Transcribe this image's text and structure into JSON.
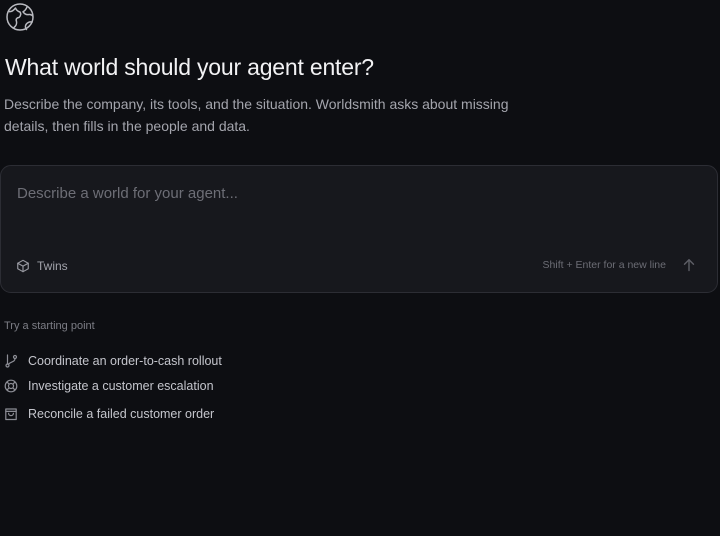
{
  "app": {
    "logo_icon": "globe-icon"
  },
  "header": {
    "title": "What world should your agent enter?",
    "subtitle": "Describe the company, its tools, and the situation. Worldsmith asks about missing details, then fills in the people and data."
  },
  "composer": {
    "placeholder": "Describe a world for your agent...",
    "value": "",
    "twins_label": "Twins",
    "twins_icon": "cube-icon",
    "hint": "Shift + Enter for a new line",
    "send_icon": "arrow-up-icon"
  },
  "starters": {
    "heading": "Try a starting point",
    "items": [
      {
        "label": "Coordinate an order-to-cash rollout",
        "icon": "git-branch-icon"
      },
      {
        "label": "Investigate a customer escalation",
        "icon": "life-buoy-icon"
      },
      {
        "label": "Reconcile a failed customer order",
        "icon": "shopping-bag-icon"
      }
    ]
  },
  "colors": {
    "background": "#0d0e12",
    "composer_background": "#17181d",
    "composer_border": "#2c2d34",
    "heading_text": "#f2f2f4",
    "muted_text": "#a4a5ad"
  }
}
